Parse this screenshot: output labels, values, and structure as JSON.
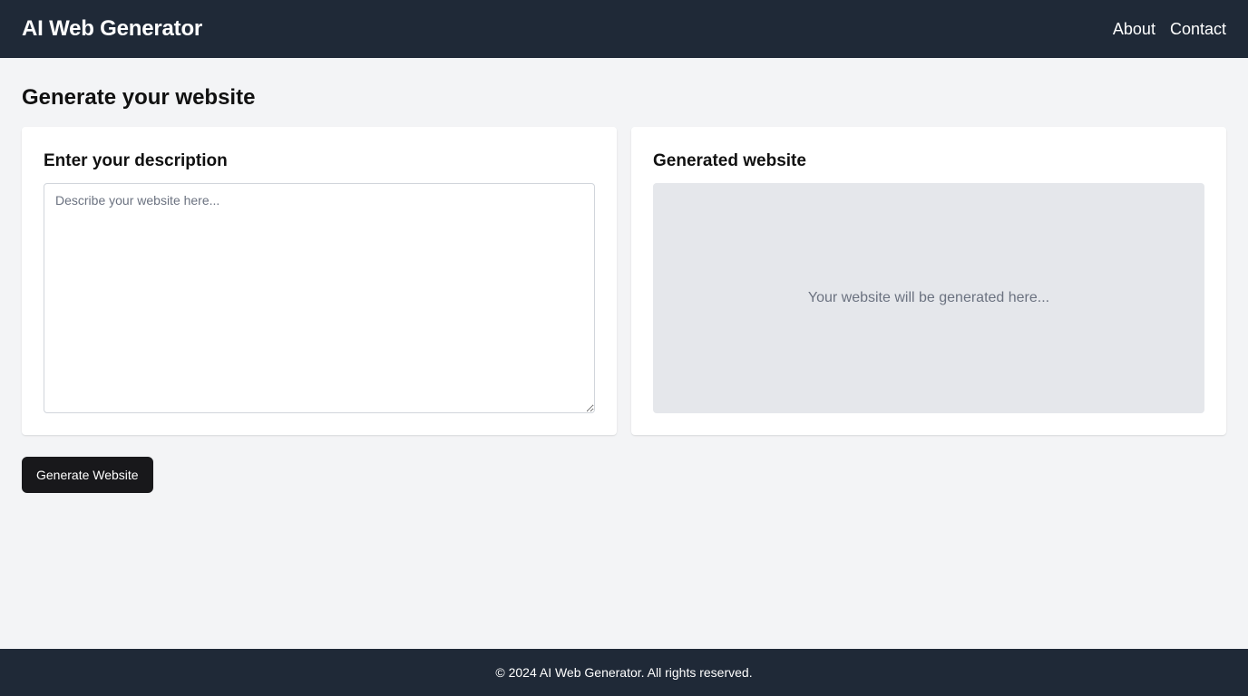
{
  "header": {
    "brand": "AI Web Generator",
    "nav": [
      {
        "label": "About"
      },
      {
        "label": "Contact"
      }
    ]
  },
  "main": {
    "title": "Generate your website",
    "input_card": {
      "title": "Enter your description",
      "placeholder": "Describe your website here...",
      "value": ""
    },
    "output_card": {
      "title": "Generated website",
      "placeholder_text": "Your website will be generated here..."
    },
    "generate_button_label": "Generate Website"
  },
  "footer": {
    "text": "© 2024 AI Web Generator. All rights reserved."
  },
  "colors": {
    "header_bg": "#1f2937",
    "page_bg": "#f3f4f6",
    "button_bg": "#18181b",
    "preview_bg": "#e5e7eb"
  }
}
